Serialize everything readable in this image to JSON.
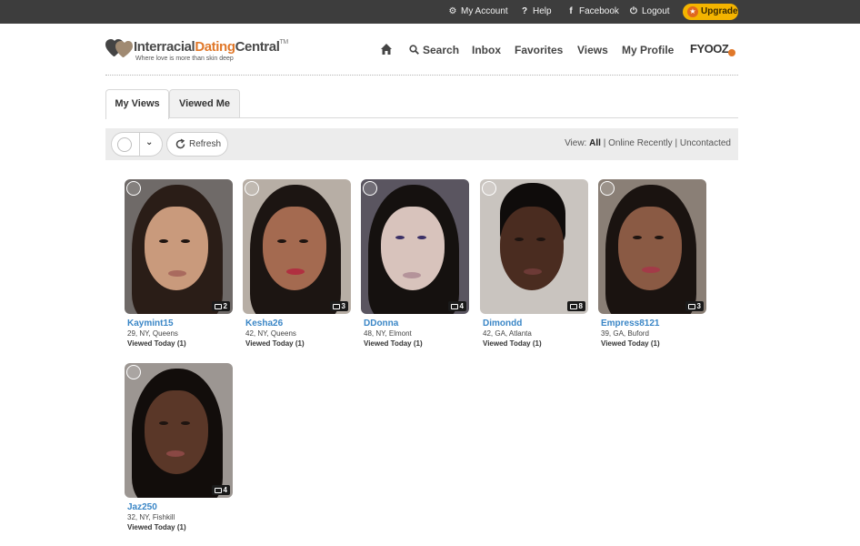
{
  "topbar": {
    "my_account": "My Account",
    "help": "Help",
    "facebook": "Facebook",
    "logout": "Logout",
    "upgrade": "Upgrade"
  },
  "logo": {
    "name_part1": "Interracial",
    "name_part2": "Dating",
    "name_part3": "Central",
    "tm": "TM",
    "tagline": "Where love is more than skin deep"
  },
  "nav": {
    "search": "Search",
    "inbox": "Inbox",
    "favorites": "Favorites",
    "views": "Views",
    "my_profile": "My Profile",
    "fyooz": "FYOOZ"
  },
  "tabs": [
    "My Views",
    "Viewed Me"
  ],
  "toolbar": {
    "refresh": "Refresh",
    "view_prefix": "View:",
    "view_all": "All",
    "sep": "|",
    "online_recently": "Online Recently",
    "uncontacted": "Uncontacted"
  },
  "profiles": [
    {
      "username": "Kaymint15",
      "info": "29, NY, Queens",
      "viewed": "Viewed Today (1)",
      "photos": "2"
    },
    {
      "username": "Kesha26",
      "info": "42, NY, Queens",
      "viewed": "Viewed Today (1)",
      "photos": "3"
    },
    {
      "username": "DDonna",
      "info": "48, NY, Elmont",
      "viewed": "Viewed Today (1)",
      "photos": "4"
    },
    {
      "username": "Dimondd",
      "info": "42, GA, Atlanta",
      "viewed": "Viewed Today (1)",
      "photos": "8"
    },
    {
      "username": "Empress8121",
      "info": "39, GA, Buford",
      "viewed": "Viewed Today (1)",
      "photos": "3"
    },
    {
      "username": "Jaz250",
      "info": "32, NY, Fishkill",
      "viewed": "Viewed Today (1)",
      "photos": "4"
    }
  ],
  "colors": {
    "topbar_bg": "#3d3d3d",
    "upgrade_bg": "#f4b400",
    "brand_orange": "#e0782a",
    "link_blue": "#3a86c6"
  }
}
